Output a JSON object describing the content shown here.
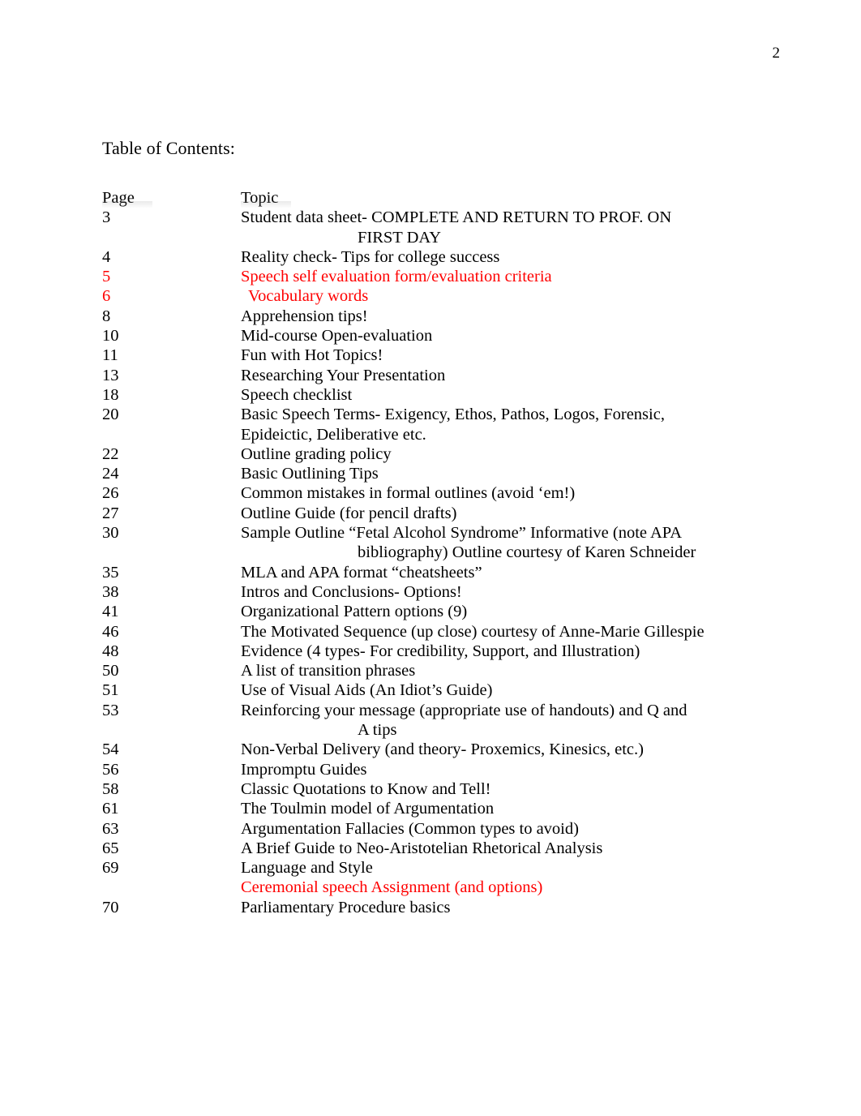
{
  "page": {
    "page_number": "2",
    "title": "Table of Contents:"
  },
  "colors": {
    "text": "#000000",
    "highlight_red": "#FF0000",
    "background": "#FFFFFF"
  },
  "toc": {
    "header": {
      "page_label": "Page",
      "topic_label": "Topic"
    },
    "entries": [
      {
        "page": "3",
        "topic": "Student data sheet- COMPLETE AND RETURN TO PROF. ON",
        "continuation": "FIRST DAY",
        "color": "black"
      },
      {
        "page": "4",
        "topic": "Reality check- Tips for college success",
        "color": "black"
      },
      {
        "page": "5",
        "topic": "Speech self evaluation form/evaluation criteria",
        "color": "red"
      },
      {
        "page": "6",
        "topic": "Vocabulary words",
        "color": "red",
        "indent": true
      },
      {
        "page": "8",
        "topic": "Apprehension tips!",
        "color": "black"
      },
      {
        "page": "10",
        "topic": "Mid-course Open-evaluation",
        "color": "black"
      },
      {
        "page": "11",
        "topic": "Fun with Hot Topics!",
        "color": "black"
      },
      {
        "page": "13",
        "topic": "Researching Your Presentation",
        "color": "black"
      },
      {
        "page": "18",
        "topic": "Speech checklist",
        "color": "black"
      },
      {
        "page": "20",
        "topic": "Basic Speech Terms- Exigency, Ethos, Pathos, Logos, Forensic,",
        "continuation_flush": "Epideictic, Deliberative etc.",
        "color": "black"
      },
      {
        "page": "22",
        "topic": "Outline grading policy",
        "color": "black"
      },
      {
        "page": "24",
        "topic": "Basic Outlining Tips",
        "color": "black"
      },
      {
        "page": "26",
        "topic": "Common mistakes in formal outlines (avoid ‘em!)",
        "color": "black"
      },
      {
        "page": "27",
        "topic": "Outline Guide (for pencil drafts)",
        "color": "black"
      },
      {
        "page": "30",
        "topic": "Sample Outline “Fetal Alcohol Syndrome” Informative (note APA",
        "continuation": "bibliography) Outline courtesy of Karen Schneider",
        "color": "black"
      },
      {
        "page": "35",
        "topic": "MLA and APA format “cheatsheets”",
        "color": "black"
      },
      {
        "page": "38",
        "topic": "Intros and Conclusions- Options!",
        "color": "black"
      },
      {
        "page": "41",
        "topic": "Organizational Pattern options (9)",
        "color": "black"
      },
      {
        "page": "46",
        "topic": "The Motivated Sequence (up close) courtesy of Anne-Marie Gillespie",
        "color": "black"
      },
      {
        "page": "48",
        "topic": "Evidence (4 types- For credibility, Support, and Illustration)",
        "color": "black"
      },
      {
        "page": "50",
        "topic": "A list of transition phrases",
        "color": "black"
      },
      {
        "page": "51",
        "topic": "Use of Visual Aids (An Idiot’s Guide)",
        "color": "black"
      },
      {
        "page": "53",
        "topic": "Reinforcing your message (appropriate use of handouts) and Q and",
        "continuation": "A tips",
        "color": "black"
      },
      {
        "page": "54",
        "topic": "Non-Verbal Delivery (and theory- Proxemics, Kinesics, etc.)",
        "color": "black"
      },
      {
        "page": "56",
        "topic": "Impromptu Guides",
        "color": "black"
      },
      {
        "page": "58",
        "topic": "Classic Quotations to Know and Tell!",
        "color": "black"
      },
      {
        "page": "61",
        "topic": "The Toulmin model of Argumentation",
        "color": "black"
      },
      {
        "page": "63",
        "topic": "Argumentation Fallacies (Common types to avoid)",
        "color": "black"
      },
      {
        "page": "65",
        "topic": "A Brief Guide to Neo-Aristotelian Rhetorical Analysis",
        "color": "black"
      },
      {
        "page": "69",
        "topic": "Language and Style",
        "color": "black"
      },
      {
        "page": "",
        "topic": "Ceremonial speech Assignment (and options)",
        "color": "red"
      },
      {
        "page": "70",
        "topic": "Parliamentary Procedure basics",
        "color": "black"
      }
    ]
  }
}
